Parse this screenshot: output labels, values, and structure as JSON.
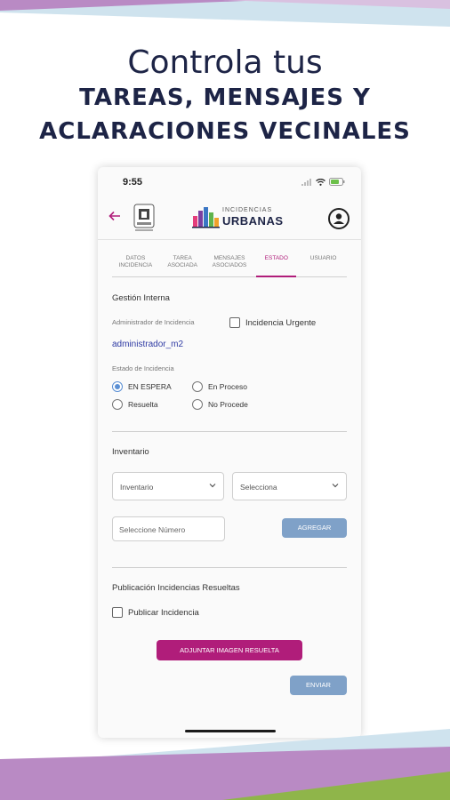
{
  "hero": {
    "line1": "Controla tus",
    "line2": "TAREAS, MENSAJES Y",
    "line3": "ACLARACIONES VECINALES"
  },
  "status_bar": {
    "time": "9:55"
  },
  "app_bar": {
    "logo_top": "INCIDENCIAS",
    "logo_main": "URBANAS"
  },
  "tabs": [
    {
      "label": "DATOS INCIDENCIA",
      "active": false
    },
    {
      "label": "TAREA ASOCIADA",
      "active": false
    },
    {
      "label": "MENSAJES ASOCIADOS",
      "active": false
    },
    {
      "label": "ESTADO",
      "active": true
    },
    {
      "label": "USUARIO",
      "active": false
    }
  ],
  "gestion": {
    "title": "Gestión Interna",
    "admin_label": "Administrador de Incidencia",
    "admin_value": "administrador_m2",
    "urgent_label": "Incidencia Urgente",
    "urgent_checked": false,
    "estado_label": "Estado de Incidencia",
    "estado_options": [
      {
        "label": "EN ESPERA",
        "selected": true
      },
      {
        "label": "En Proceso",
        "selected": false
      },
      {
        "label": "Resuelta",
        "selected": false
      },
      {
        "label": "No Procede",
        "selected": false
      }
    ]
  },
  "inventario": {
    "title": "Inventario",
    "select1": "Inventario",
    "select2": "Selecciona",
    "number_placeholder": "Seleccione Número",
    "add_button": "AGREGAR"
  },
  "publicacion": {
    "title": "Publicación Incidencias Resueltas",
    "checkbox_label": "Publicar Incidencia",
    "checkbox_checked": false,
    "attach_button": "ADJUNTAR IMAGEN RESUELTA",
    "send_button": "ENVIAR"
  },
  "colors": {
    "accent": "#b01d7a",
    "navy": "#1d2446",
    "button_blue": "#7fa1c8",
    "radio_blue": "#5a8fd4"
  }
}
